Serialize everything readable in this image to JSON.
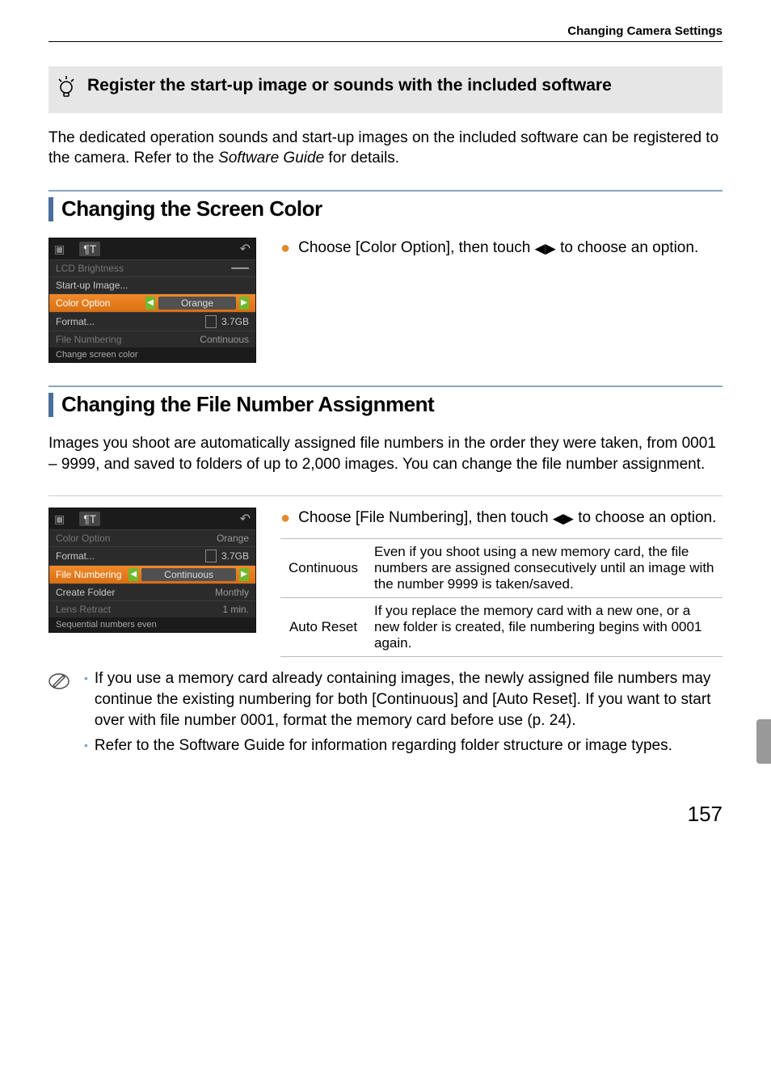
{
  "header": {
    "section": "Changing Camera Settings"
  },
  "tip": {
    "title": "Register the start-up image or sounds with the included software",
    "body_prefix": "The dedicated operation sounds and start-up images on the included software can be registered to the camera. Refer to the ",
    "body_italic": "Software Guide",
    "body_suffix": " for details."
  },
  "section_color": {
    "heading": "Changing the Screen Color",
    "instruction_prefix": "Choose [Color Option], then touch ",
    "instruction_suffix": " to choose an option.",
    "screenshot": {
      "rows": [
        {
          "label": "LCD Brightness",
          "value": "",
          "dim": true
        },
        {
          "label": "Start-up Image...",
          "value": ""
        },
        {
          "label": "Color Option",
          "value": "Orange",
          "highlight": true
        },
        {
          "label": "Format...",
          "value": "3.7GB",
          "card": true
        },
        {
          "label": "File Numbering",
          "value": "Continuous",
          "dim": true
        }
      ],
      "footer": "Change screen color"
    }
  },
  "section_file": {
    "heading": "Changing the File Number Assignment",
    "intro": "Images you shoot are automatically assigned file numbers in the order they were taken, from 0001 – 9999, and saved to folders of up to 2,000 images. You can change the file number assignment.",
    "instruction_prefix": "Choose [File Numbering], then touch ",
    "instruction_suffix": " to choose an option.",
    "options": [
      {
        "name": "Continuous",
        "desc": "Even if you shoot using a new memory card, the file numbers are assigned consecutively until an image with the number 9999 is taken/saved."
      },
      {
        "name": "Auto Reset",
        "desc": "If you replace the memory card with a new one, or a new folder is created, file numbering begins with 0001 again."
      }
    ],
    "screenshot": {
      "rows": [
        {
          "label": "Color Option",
          "value": "Orange",
          "dim": true
        },
        {
          "label": "Format...",
          "value": "3.7GB",
          "card": true
        },
        {
          "label": "File Numbering",
          "value": "Continuous",
          "highlight": true
        },
        {
          "label": "Create Folder",
          "value": "Monthly"
        },
        {
          "label": "Lens Retract",
          "value": "1 min.",
          "dim": true
        }
      ],
      "footer": "Sequential numbers even"
    }
  },
  "notes": {
    "item1": "If you use a memory card already containing images, the newly assigned file numbers may continue the existing numbering for both [Continuous] and [Auto Reset]. If you want to start over with file number 0001, format the memory card before use (p. 24).",
    "item2_prefix": "Refer to the ",
    "item2_italic": "Software Guide",
    "item2_suffix": " for information regarding folder structure or image types."
  },
  "page_number": "157"
}
